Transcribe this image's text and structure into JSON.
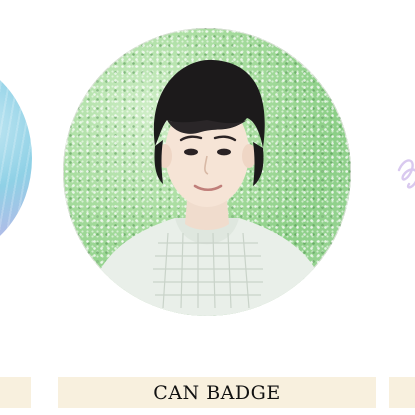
{
  "product": {
    "label": "CAN BADGE"
  },
  "colors": {
    "label_background": "#f8f0de",
    "label_text": "#111111",
    "glitter_green": "#a9dda0",
    "neighbor_badge_blue": "#8fd1e6"
  }
}
